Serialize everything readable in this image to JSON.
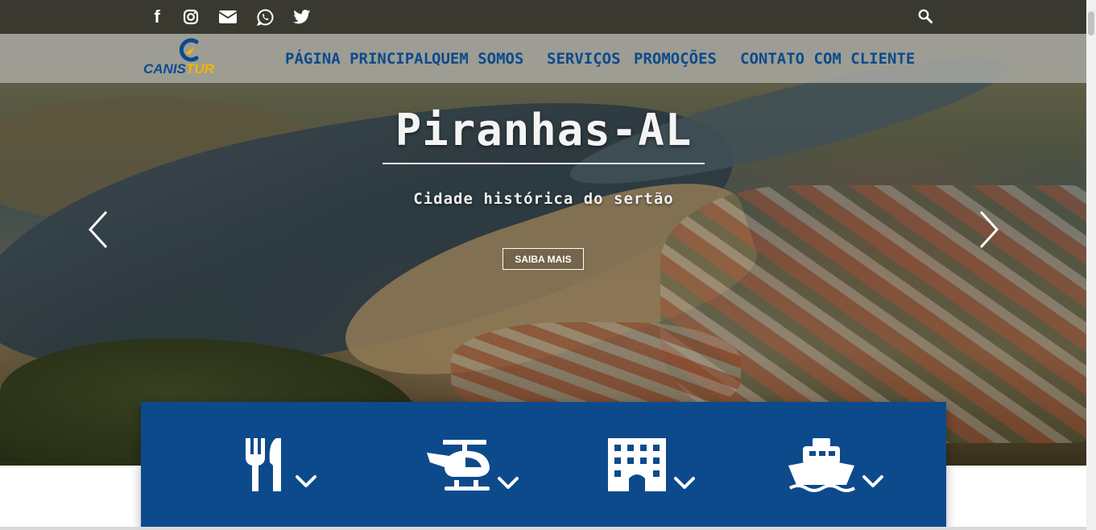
{
  "social": {
    "facebook_label": "f",
    "icons": [
      "facebook-icon",
      "instagram-icon",
      "email-icon",
      "whatsapp-icon",
      "twitter-icon",
      "search-icon"
    ]
  },
  "brand": {
    "logo_part1": "CANIS",
    "logo_part2": "TUR",
    "primary_color": "#0d4a8c",
    "accent_color": "#f2b500"
  },
  "nav": {
    "items": [
      {
        "label": "PÁGINA PRINCIPAL"
      },
      {
        "label": "QUEM SOMOS"
      },
      {
        "label": "SERVIÇOS"
      },
      {
        "label": "PROMOÇÕES"
      },
      {
        "label": "CONTATO COM CLIENTE"
      }
    ]
  },
  "hero": {
    "title": "Piranhas-AL",
    "subtitle": "Cidade histórica do sertão",
    "cta_label": "SAIBA MAIS",
    "prev_icon": "chevron-left-icon",
    "next_icon": "chevron-right-icon"
  },
  "services": {
    "panel_color": "#0d4a8c",
    "items": [
      {
        "icon": "restaurant-icon"
      },
      {
        "icon": "helicopter-icon"
      },
      {
        "icon": "hotel-icon"
      },
      {
        "icon": "ship-icon"
      }
    ]
  }
}
